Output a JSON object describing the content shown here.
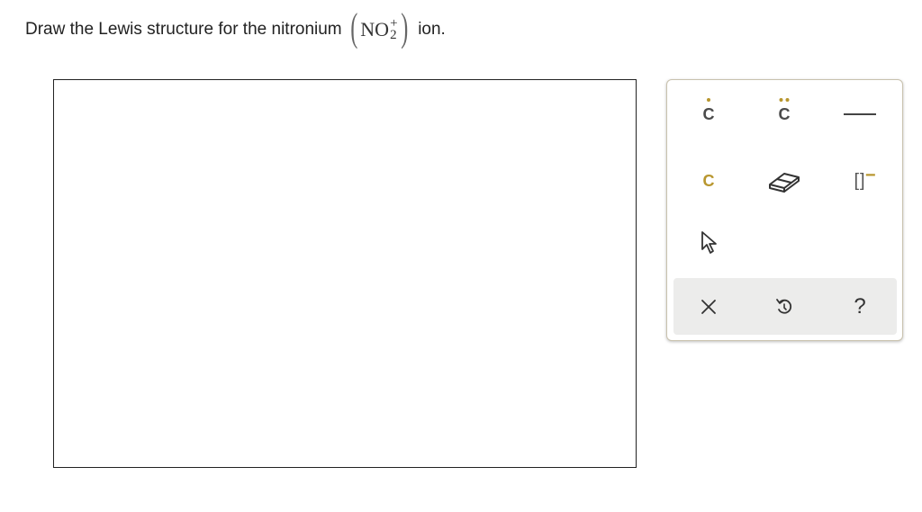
{
  "prompt": {
    "text_before": "Draw the Lewis structure for the nitronium",
    "formula_main": "NO",
    "formula_sup": "+",
    "formula_sub": "2",
    "paren_open": "(",
    "paren_close": ")",
    "text_after": "ion."
  },
  "palette": {
    "tools": {
      "atom_single_dot": "C",
      "atom_lone_pair": "C",
      "single_bond_icon": "single-bond",
      "atom_plain": "C",
      "eraser_icon": "eraser",
      "bracket_charge": "[]",
      "bracket_charge_sign": "−",
      "pointer_icon": "cursor-arrow"
    },
    "actions": {
      "clear": "×",
      "undo_icon": "undo",
      "help": "?"
    }
  },
  "colors": {
    "accent": "#b8962e",
    "text": "#222222",
    "palette_border": "#c9c2ae",
    "action_bar_bg": "#ececeb"
  }
}
